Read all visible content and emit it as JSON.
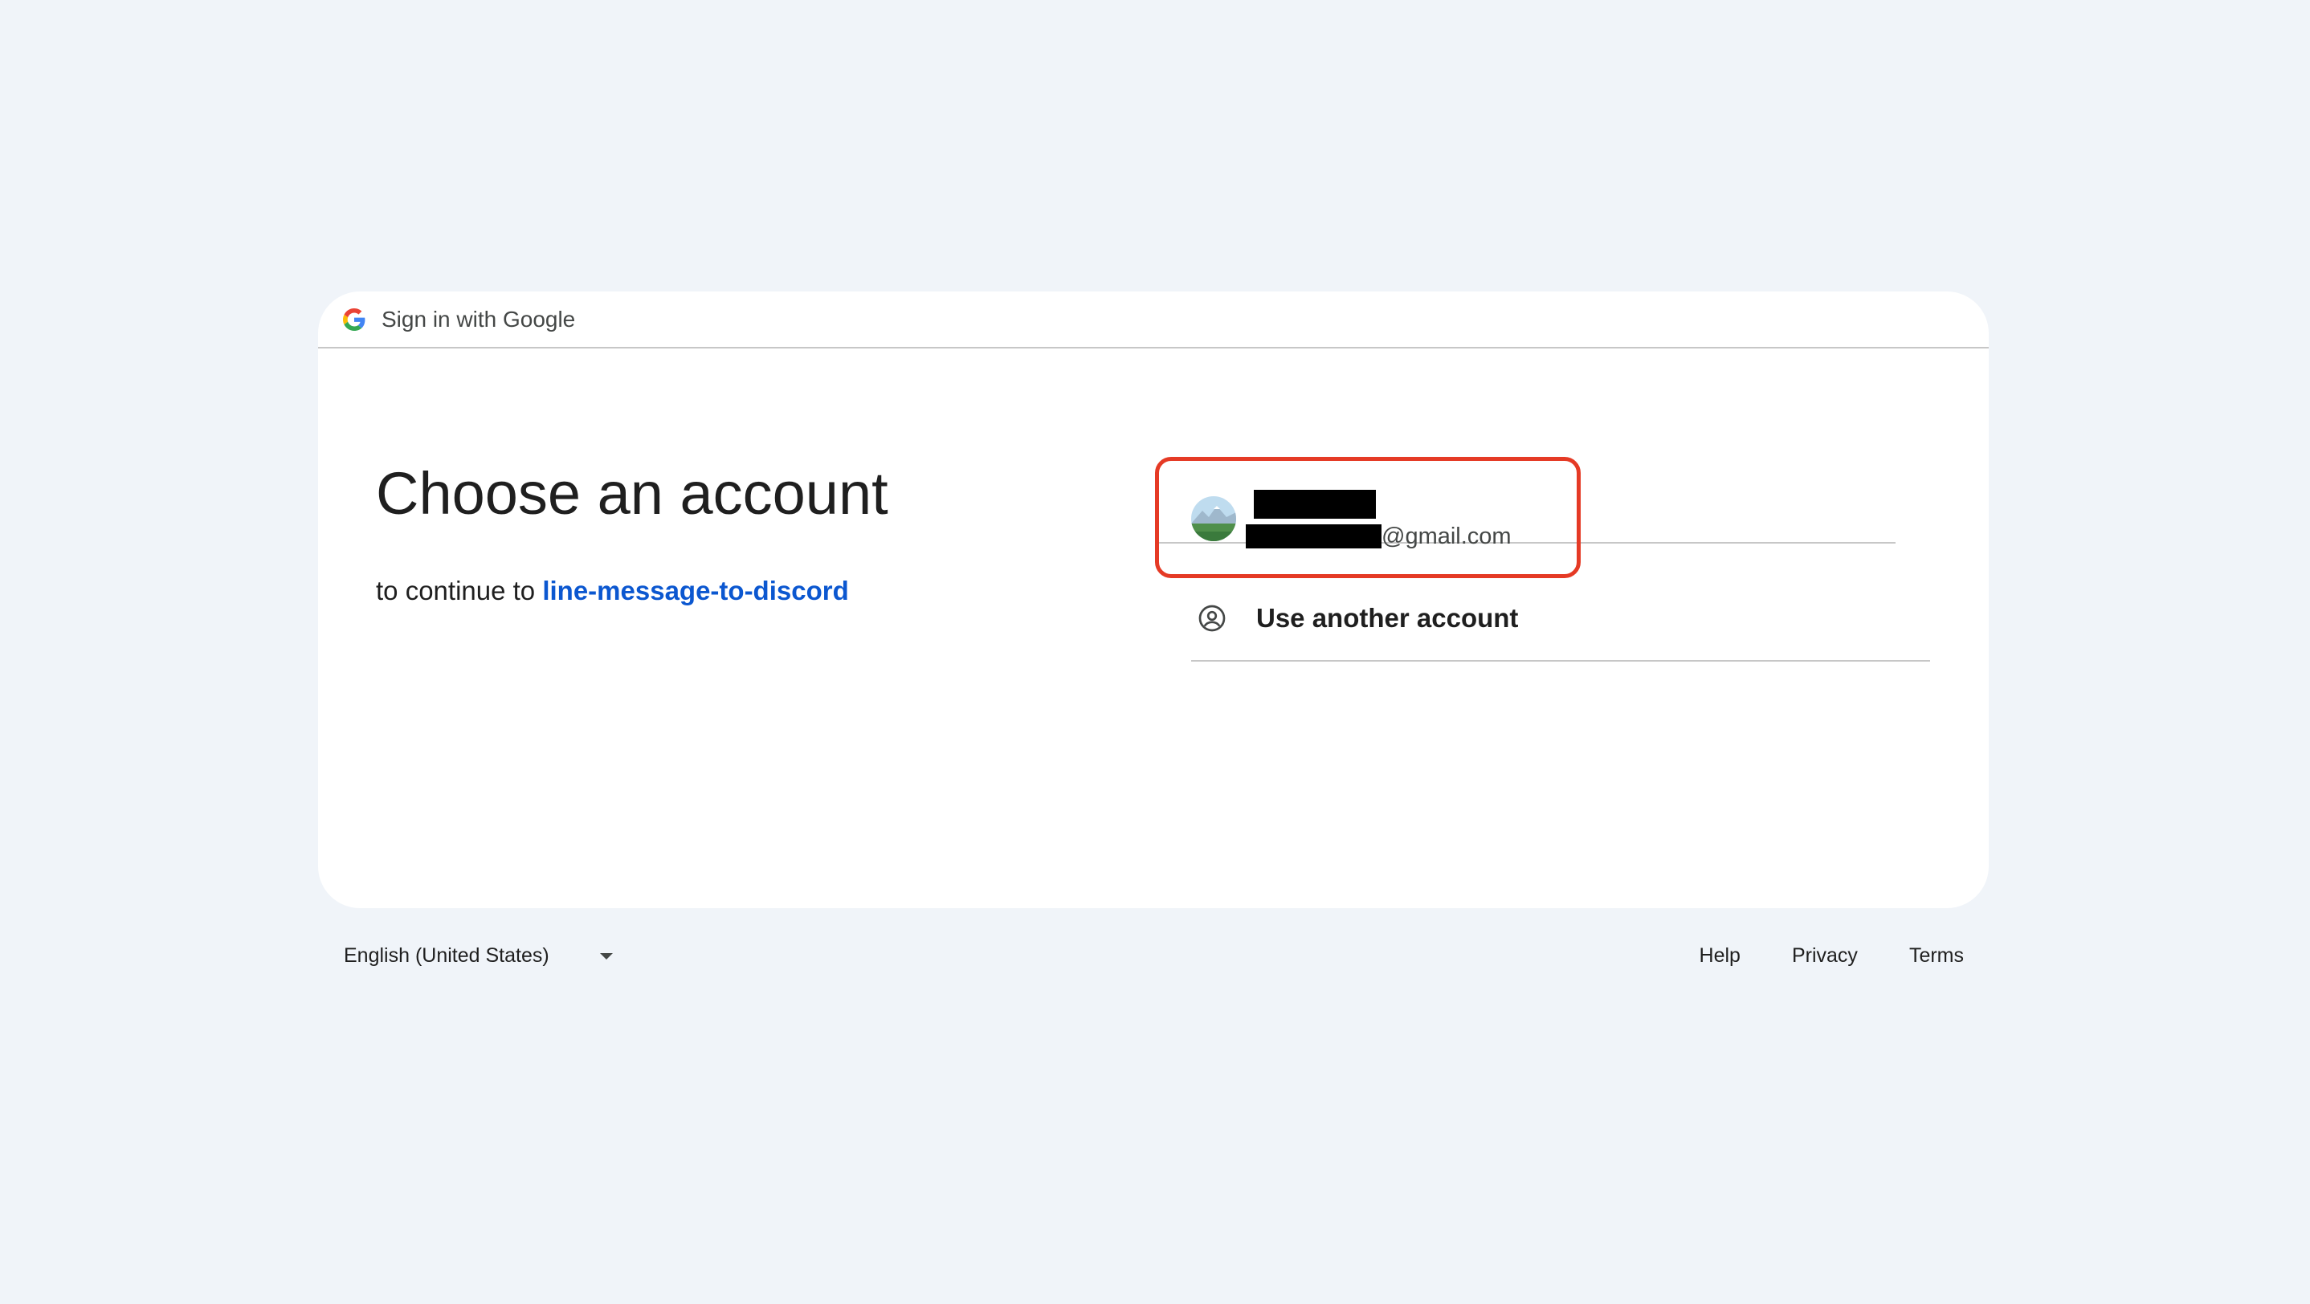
{
  "header": {
    "title": "Sign in with Google",
    "logo_icon": "google-g-icon"
  },
  "main": {
    "heading": "Choose an account",
    "subtitle_prefix": "to continue to",
    "app_name": "line-message-to-discord"
  },
  "accounts": [
    {
      "name": "[redacted]",
      "email_suffix": "@gmail.com",
      "avatar_icon": "landscape-avatar-icon",
      "highlighted": true
    }
  ],
  "another_account": {
    "label": "Use another account",
    "icon": "person-circle-icon"
  },
  "footer": {
    "language": "English (United States)",
    "links": [
      "Help",
      "Privacy",
      "Terms"
    ]
  },
  "colors": {
    "background": "#f0f4f9",
    "card": "#ffffff",
    "link": "#0b57d0",
    "highlight": "#e53a25"
  }
}
